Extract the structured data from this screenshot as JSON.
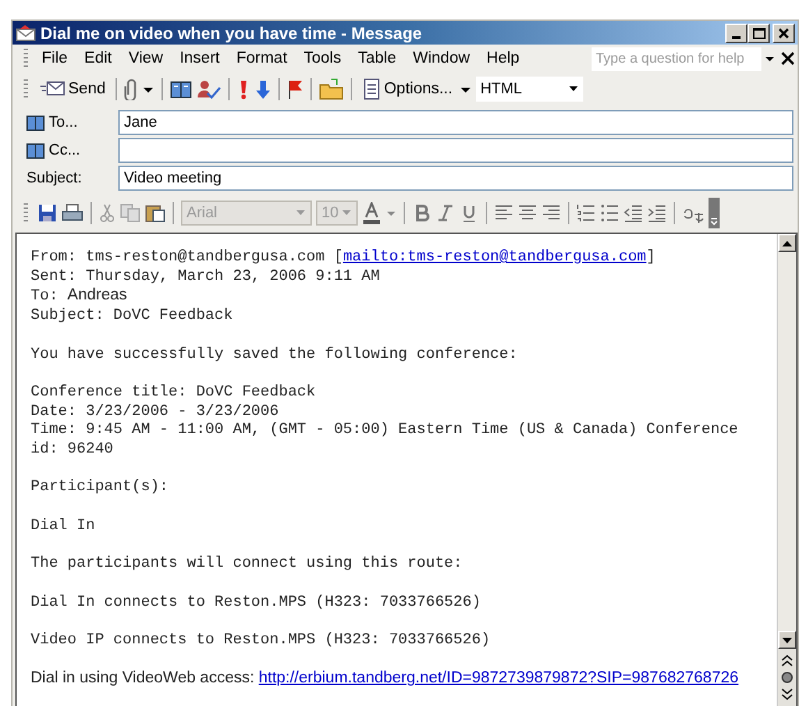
{
  "window": {
    "title": "Dial me on video when you have time - Message"
  },
  "menu": [
    "File",
    "Edit",
    "View",
    "Insert",
    "Format",
    "Tools",
    "Table",
    "Window",
    "Help"
  ],
  "help_search": {
    "placeholder": "Type a question for help"
  },
  "toolbar": {
    "send": "Send",
    "options": "Options...",
    "format": "HTML"
  },
  "address": [
    {
      "label": "To...",
      "value": "Jane",
      "kind": "book"
    },
    {
      "label": "Cc...",
      "kind": "book"
    },
    {
      "label": "Subject:",
      "value": "Video meeting",
      "kind": "plain"
    }
  ],
  "format_toolbar": {
    "font": {
      "value": "Arial",
      "disabled": true
    },
    "size": {
      "value": "10",
      "disabled": true
    }
  },
  "body": [
    [
      [
        {
          "text": "From: tms-reston@tandbergusa.com [",
          "kind": "mono"
        },
        {
          "text": "mailto:tms-reston@tandbergusa.com",
          "kind": "link"
        },
        {
          "text": "]",
          "kind": "mono"
        }
      ],
      [
        {
          "text": "Sent: Thursday, March 23, 2006 9:11 AM",
          "kind": "mono"
        }
      ],
      [
        {
          "text": "To: ",
          "kind": "mono"
        },
        {
          "text": "Andreas",
          "kind": "sans"
        }
      ],
      [
        {
          "text": "Subject: DoVC Feedback",
          "kind": "mono"
        }
      ]
    ],
    [
      [
        {
          "text": "You have successfully saved the following conference:",
          "kind": "mono"
        }
      ]
    ],
    [
      [
        {
          "text": "Conference title: DoVC Feedback",
          "kind": "mono"
        }
      ],
      [
        {
          "text": "Date: 3/23/2006 - 3/23/2006",
          "kind": "mono"
        }
      ],
      [
        {
          "text": "Time: 9:45 AM - 11:00 AM, (GMT - 05:00) Eastern Time (US & Canada) Conference id: 96240",
          "kind": "mono"
        }
      ]
    ],
    [
      [
        {
          "text": "Participant(s):",
          "kind": "mono"
        }
      ]
    ],
    [
      [
        {
          "text": "Dial In",
          "kind": "mono"
        }
      ]
    ],
    [
      [
        {
          "text": "The participants will connect using this route:",
          "kind": "mono"
        }
      ]
    ],
    [
      [
        {
          "text": "Dial In connects to Reston.MPS (H323: 7033766526)",
          "kind": "mono"
        }
      ]
    ],
    [
      [
        {
          "text": "Video IP connects to Reston.MPS (H323: 7033766526)",
          "kind": "mono"
        }
      ]
    ],
    [
      [
        {
          "text": "Dial in using VideoWeb access: ",
          "kind": "sans"
        },
        {
          "text": "http://erbium.tandberg.net/ID=9872739879872?SIP=987682768726",
          "kind": "sanslink"
        }
      ]
    ]
  ]
}
